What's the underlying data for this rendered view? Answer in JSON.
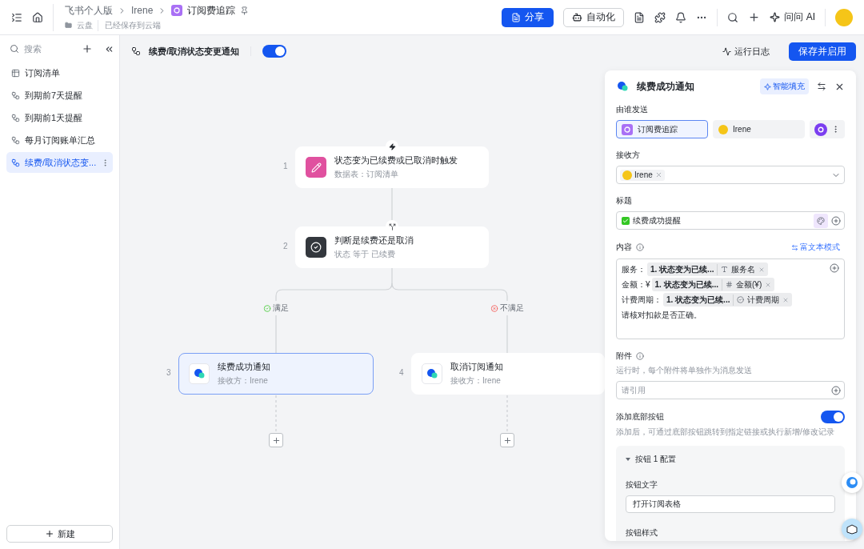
{
  "topbar": {
    "breadcrumbs": [
      "飞书个人版",
      "Irene"
    ],
    "doc_title": "订阅费追踪",
    "location": "云盘",
    "save_status": "已经保存到云端",
    "share_button": "分享",
    "automation_button": "自动化",
    "ask_ai": "问问 AI"
  },
  "sidebar": {
    "search_placeholder": "搜索",
    "items": [
      {
        "label": "订阅清单",
        "kind": "table",
        "selected": false
      },
      {
        "label": "到期前7天提醒",
        "kind": "workflow",
        "selected": false
      },
      {
        "label": "到期前1天提醒",
        "kind": "workflow",
        "selected": false
      },
      {
        "label": "每月订阅账单汇总",
        "kind": "workflow",
        "selected": false
      },
      {
        "label": "续费/取消状态变...",
        "kind": "workflow",
        "selected": true
      }
    ],
    "new_button": "新建"
  },
  "workflow": {
    "title": "续费/取消状态变更通知",
    "enabled": true,
    "run_log": "运行日志",
    "save_button": "保存并启用"
  },
  "flow": {
    "nodes": [
      {
        "number": "1",
        "title": "状态变为已续费或已取消时触发",
        "subtitle": "数据表：订阅清单",
        "kind": "trigger",
        "selected": false
      },
      {
        "number": "2",
        "title": "判断是续费还是取消",
        "subtitle": "状态 等于 已续费",
        "kind": "condition",
        "selected": false
      },
      {
        "number": "3",
        "title": "续费成功通知",
        "subtitle": "接收方：Irene",
        "kind": "message",
        "selected": true
      },
      {
        "number": "4",
        "title": "取消订阅通知",
        "subtitle": "接收方：Irene",
        "kind": "message",
        "selected": false
      }
    ],
    "branches": [
      {
        "label": "满足",
        "kind": "yes"
      },
      {
        "label": "不满足",
        "kind": "no"
      }
    ]
  },
  "panel": {
    "title": "续费成功通知",
    "smart_fill": "智能填充",
    "sender_label": "由谁发送",
    "senders": [
      {
        "label": "订阅费追踪",
        "kind": "app",
        "selected": true
      },
      {
        "label": "Irene",
        "kind": "person",
        "selected": false
      }
    ],
    "receiver_label": "接收方",
    "receivers": [
      "Irene"
    ],
    "title_label": "标题",
    "title_value": "续费成功提醒",
    "content_label": "内容",
    "rich_text_link": "富文本模式",
    "content_lines": [
      {
        "prefix": "服务：",
        "source": "1. 状态变为已续...",
        "field": "服务名",
        "kind": "text"
      },
      {
        "prefix": "金额：¥",
        "source": "1. 状态变为已续...",
        "field": "金额(¥)",
        "kind": "number"
      },
      {
        "prefix": "计费周期：",
        "source": "1. 状态变为已续...",
        "field": "计费周期",
        "kind": "option"
      }
    ],
    "content_text": "请核对扣款是否正确。",
    "attachment_label": "附件",
    "attachment_hint": "运行时，每个附件将单独作为消息发送",
    "attachment_placeholder": "请引用",
    "footer_label": "添加底部按钮",
    "footer_enabled": true,
    "footer_hint": "添加后，可通过底部按钮跳转到指定链接或执行新增/修改记录",
    "button_config": {
      "title": "按钮 1 配置",
      "expanded": true,
      "text_label": "按钮文字",
      "text_value": "打开订阅表格",
      "style_label": "按钮样式"
    }
  }
}
